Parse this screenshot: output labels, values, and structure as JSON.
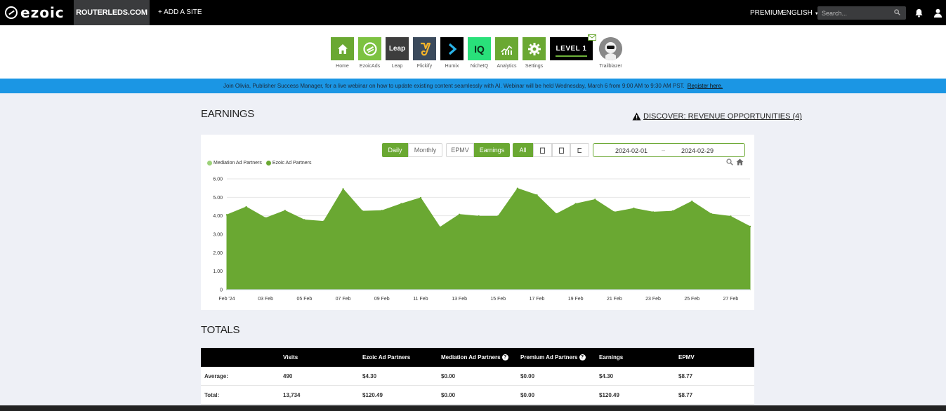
{
  "nav": {
    "logo": "ezoic",
    "site": "ROUTERLEDS.COM",
    "add_site": "+ ADD A SITE",
    "premium": "PREMIUM",
    "language": "ENGLISH",
    "search_placeholder": "Search..."
  },
  "apps": [
    {
      "label": "Home",
      "icon": "home-icon",
      "color": "#6aa832",
      "text": ""
    },
    {
      "label": "EzoicAds",
      "icon": "ezoicads-icon",
      "color": "#7dc242",
      "text": ""
    },
    {
      "label": "Leap",
      "icon": "leap-icon",
      "color": "#3d3d3d",
      "text": "Leap"
    },
    {
      "label": "Flickify",
      "icon": "flickify-icon",
      "color": "#3b4a5c",
      "text": ""
    },
    {
      "label": "Humix",
      "icon": "humix-icon",
      "color": "#000000",
      "text": ""
    },
    {
      "label": "NicheIQ",
      "icon": "nicheiq-icon",
      "color": "#29e07a",
      "text": "IQ"
    },
    {
      "label": "Analytics",
      "icon": "analytics-icon",
      "color": "#6aa832",
      "text": ""
    },
    {
      "label": "Settings",
      "icon": "settings-icon",
      "color": "#6aa832",
      "text": ""
    }
  ],
  "level": "LEVEL 1",
  "profile_label": "Trailblazer",
  "banner": {
    "text": "Join Olivia, Publisher Success Manager, for a live webinar on how to update existing content seamlessly with AI. Webinar will be held Wednesday, March 6 from 9:00 AM to 9:30 AM PST.",
    "link": "Register here."
  },
  "earnings": {
    "title": "EARNINGS",
    "discover": "DISCOVER: REVENUE OPPORTUNITIES (4)",
    "buttons": {
      "daily": "Daily",
      "monthly": "Monthly",
      "epmv": "EPMV",
      "earnings": "Earnings",
      "all": "All"
    },
    "date_start": "2024-02-01",
    "date_sep": "–",
    "date_end": "2024-02-29"
  },
  "chart_data": {
    "type": "area",
    "series": [
      {
        "name": "Mediation Ad Partners",
        "color": "#9dd27a",
        "values": [
          0,
          0,
          0,
          0,
          0,
          0,
          0,
          0,
          0,
          0,
          0,
          0,
          0,
          0,
          0,
          0,
          0,
          0,
          0,
          0,
          0,
          0,
          0,
          0,
          0,
          0,
          0,
          0,
          0
        ]
      },
      {
        "name": "Ezoic Ad Partners",
        "color": "#6aa832",
        "values": [
          4.05,
          4.48,
          3.88,
          4.28,
          3.78,
          3.7,
          5.45,
          4.25,
          4.28,
          4.65,
          4.97,
          3.38,
          4.07,
          3.98,
          3.98,
          5.48,
          5.12,
          4.1,
          4.65,
          4.88,
          4.2,
          4.4,
          4.2,
          4.25,
          4.78,
          4.1,
          3.97,
          3.42
        ]
      }
    ],
    "x_dates": [
      "2024-02-01",
      "2024-02-02",
      "2024-02-03",
      "2024-02-04",
      "2024-02-05",
      "2024-02-06",
      "2024-02-07",
      "2024-02-08",
      "2024-02-09",
      "2024-02-10",
      "2024-02-11",
      "2024-02-12",
      "2024-02-13",
      "2024-02-14",
      "2024-02-15",
      "2024-02-16",
      "2024-02-17",
      "2024-02-18",
      "2024-02-19",
      "2024-02-20",
      "2024-02-21",
      "2024-02-22",
      "2024-02-23",
      "2024-02-24",
      "2024-02-25",
      "2024-02-26",
      "2024-02-27",
      "2024-02-28"
    ],
    "x_tick_labels": [
      "Feb '24",
      "03 Feb",
      "05 Feb",
      "07 Feb",
      "09 Feb",
      "11 Feb",
      "13 Feb",
      "15 Feb",
      "17 Feb",
      "19 Feb",
      "21 Feb",
      "23 Feb",
      "25 Feb",
      "27 Feb"
    ],
    "y_tick_labels": [
      "0",
      "1.00",
      "2.00",
      "3.00",
      "4.00",
      "5.00",
      "6.00"
    ],
    "ylim": [
      0,
      6
    ],
    "grid": true,
    "legend": "top-left"
  },
  "totals": {
    "title": "TOTALS",
    "columns": [
      "",
      "Visits",
      "Ezoic Ad Partners",
      "Mediation Ad Partners",
      "Premium Ad Partners",
      "Earnings",
      "EPMV"
    ],
    "rows": [
      [
        "Average:",
        "490",
        "$4.30",
        "$0.00",
        "$0.00",
        "$4.30",
        "$8.77"
      ],
      [
        "Total:",
        "13,734",
        "$120.49",
        "$0.00",
        "$0.00",
        "$120.49",
        "$8.77"
      ]
    ]
  }
}
